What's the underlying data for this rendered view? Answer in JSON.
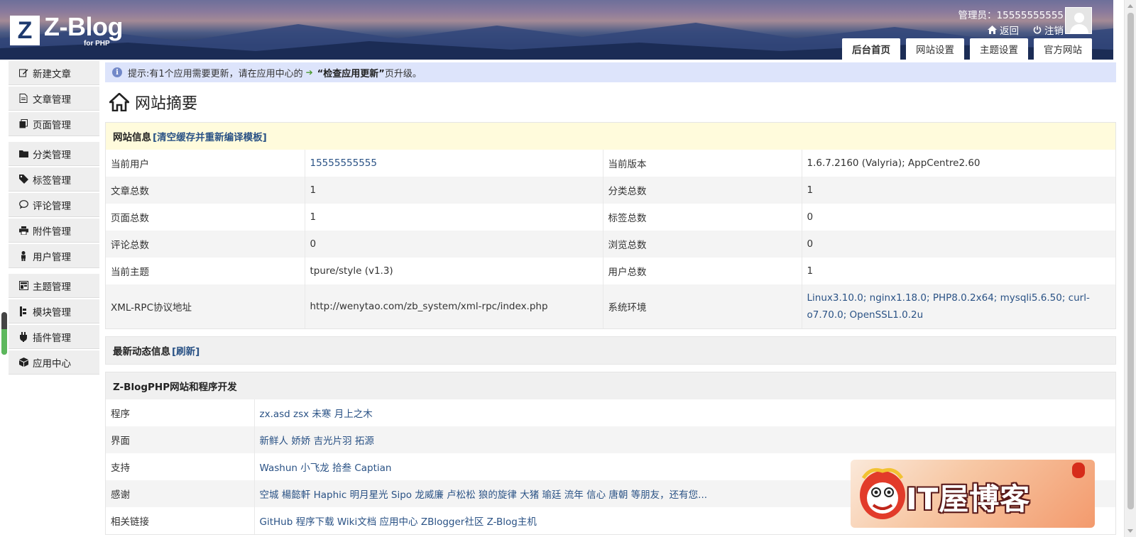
{
  "header": {
    "logo_letter": "Z",
    "logo_name": "Z-Blog",
    "logo_sub": "for PHP",
    "admin_line": "管理员：15555555555",
    "back_label": "返回",
    "logout_label": "注销",
    "tabs": [
      {
        "label": "后台首页",
        "active": true
      },
      {
        "label": "网站设置"
      },
      {
        "label": "主题设置"
      },
      {
        "label": "官方网站"
      }
    ]
  },
  "sidebar": {
    "items": [
      {
        "label": "新建文章",
        "icon": "edit-icon"
      },
      {
        "label": "文章管理",
        "icon": "file-icon"
      },
      {
        "label": "页面管理",
        "icon": "files-icon"
      },
      {
        "label": "分类管理",
        "icon": "folder-icon"
      },
      {
        "label": "标签管理",
        "icon": "tag-icon"
      },
      {
        "label": "评论管理",
        "icon": "comment-icon"
      },
      {
        "label": "附件管理",
        "icon": "printer-icon"
      },
      {
        "label": "用户管理",
        "icon": "user-icon"
      },
      {
        "label": "主题管理",
        "icon": "layout-icon"
      },
      {
        "label": "模块管理",
        "icon": "module-icon"
      },
      {
        "label": "插件管理",
        "icon": "plugin-icon"
      },
      {
        "label": "应用中心",
        "icon": "box-icon"
      }
    ]
  },
  "notice": {
    "prefix": "提示:有1个应用需要更新，请在应用中心的",
    "highlight": "“检查应用更新”",
    "suffix": "页升级。"
  },
  "page_title": "网站摘要",
  "site_info": {
    "title": "网站信息",
    "action": "[清空缓存并重新编译模板]",
    "rows": [
      {
        "k1": "当前用户",
        "v1": "15555555555",
        "v1_link": true,
        "k2": "当前版本",
        "v2": "1.6.7.2160 (Valyria); AppCentre2.60"
      },
      {
        "k1": "文章总数",
        "v1": "1",
        "k2": "分类总数",
        "v2": "1"
      },
      {
        "k1": "页面总数",
        "v1": "1",
        "k2": "标签总数",
        "v2": "0"
      },
      {
        "k1": "评论总数",
        "v1": "0",
        "k2": "浏览总数",
        "v2": "0"
      },
      {
        "k1": "当前主题",
        "v1": "tpure/style (v1.3)",
        "k2": "用户总数",
        "v2": "1"
      },
      {
        "k1": "XML-RPC协议地址",
        "v1": "http://wenytao.com/zb_system/xml-rpc/index.php",
        "k2": "系统环境",
        "v2": "Linux3.10.0; nginx1.18.0; PHP8.0.2x64; mysqli5.6.50; curl-o7.70.0; OpenSSL1.0.2u",
        "v2_link": true
      }
    ]
  },
  "news": {
    "title": "最新动态信息",
    "action": "[刷新]"
  },
  "dev": {
    "title": "Z-BlogPHP网站和程序开发",
    "rows": [
      {
        "k": "程序",
        "v": "zx.asd zsx 未寒 月上之木"
      },
      {
        "k": "界面",
        "v": "新鲜人 娇娇 吉光片羽 拓源"
      },
      {
        "k": "支持",
        "v": "Washun 小飞龙 拾叁 Captian"
      },
      {
        "k": "感谢",
        "v": "空城 楊懿軒 Haphic 明月星光 Sipo 龙威廉 卢松松 狼的旋律 大猪 瑜廷 流年 信心 唐朝 等朋友，还有您..."
      },
      {
        "k": "相关链接",
        "v": "GitHub 程序下载  Wiki文档  应用中心  ZBlogger社区  Z-Blog主机"
      }
    ]
  },
  "banner": {
    "text": "IT屋博客"
  },
  "colors": {
    "link": "#2a5285",
    "notice_bg": "#dde4fb",
    "panel_yellow": "#fffbdc"
  }
}
